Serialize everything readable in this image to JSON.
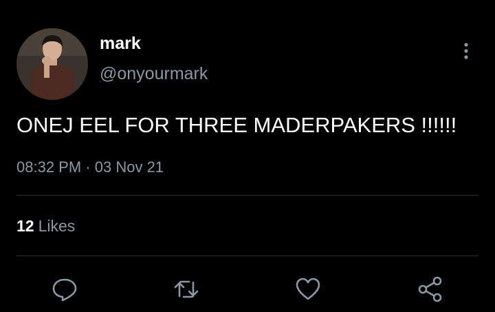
{
  "tweet": {
    "author": {
      "display_name": "mark",
      "handle": "@onyourmark",
      "avatar_icon": "profile-photo"
    },
    "text": "ONEJ EEL FOR THREE MADERPAKERS !!!!!!",
    "time": "08:32 PM",
    "separator": "·",
    "date": "03 Nov 21",
    "likes": {
      "count": "12",
      "label": "Likes"
    },
    "more_icon": "more-vertical-icon",
    "actions": [
      {
        "name": "reply",
        "icon": "comment-icon"
      },
      {
        "name": "retweet",
        "icon": "retweet-icon"
      },
      {
        "name": "like",
        "icon": "heart-icon"
      },
      {
        "name": "share",
        "icon": "share-icon"
      }
    ]
  },
  "colors": {
    "background": "#000000",
    "text_primary": "#ffffff",
    "text_secondary": "#8b98a5",
    "divider": "#2f3336"
  }
}
